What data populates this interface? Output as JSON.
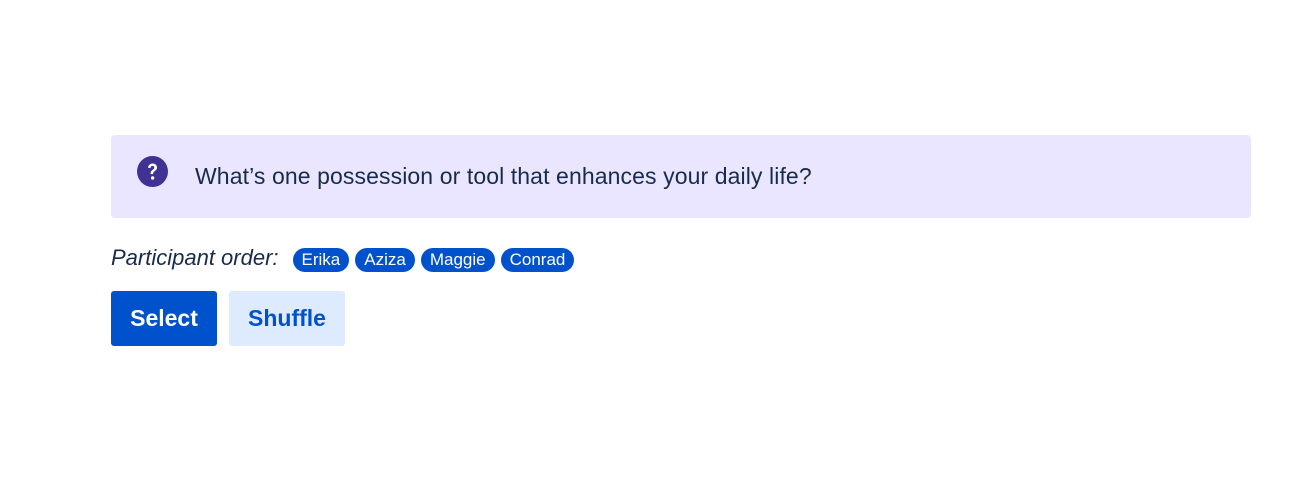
{
  "question": {
    "icon": "question-circle-icon",
    "text": "What’s one possession or tool that enhances your daily life?"
  },
  "participants": {
    "label": "Participant order:",
    "names": [
      "Erika",
      "Aziza",
      "Maggie",
      "Conrad"
    ]
  },
  "actions": {
    "select_label": "Select",
    "shuffle_label": "Shuffle"
  },
  "colors": {
    "panel_bg": "#eae6ff",
    "icon": "#403294",
    "primary": "#0052cc",
    "secondary_bg": "#deebff",
    "text": "#172b4d"
  }
}
